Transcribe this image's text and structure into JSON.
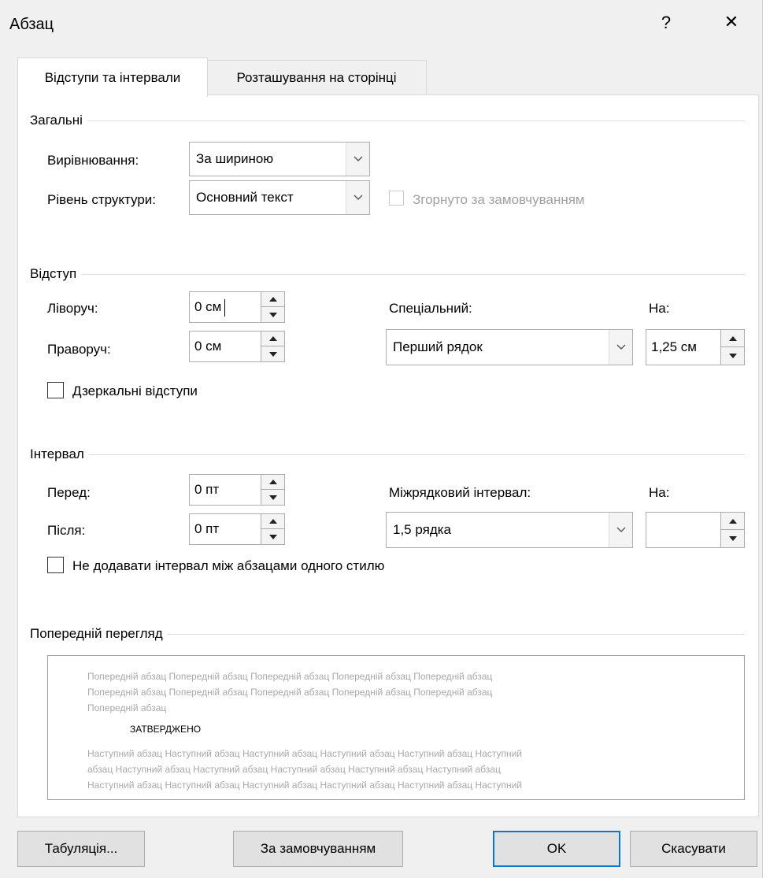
{
  "dialog": {
    "title": "Абзац",
    "help_glyph": "?",
    "close_glyph": "✕"
  },
  "tabs": [
    {
      "label": "Відступи та інтервали",
      "active": true
    },
    {
      "label": "Розташування на сторінці",
      "active": false
    }
  ],
  "general": {
    "heading": "Загальні",
    "alignment_label": "Вирівнювання:",
    "alignment_value": "За шириною",
    "outline_label": "Рівень структури:",
    "outline_value": "Основний текст",
    "collapsed_label": "Згорнуто за замовчуванням"
  },
  "indent": {
    "heading": "Відступ",
    "left_label": "Ліворуч:",
    "left_value": "0 см",
    "right_label": "Праворуч:",
    "right_value": "0 см",
    "special_label": "Спеціальний:",
    "special_value": "Перший рядок",
    "by_label": "На:",
    "by_value": "1,25 см",
    "mirror_label": "Дзеркальні відступи"
  },
  "spacing": {
    "heading": "Інтервал",
    "before_label": "Перед:",
    "before_value": "0 пт",
    "after_label": "Після:",
    "after_value": "0 пт",
    "line_label": "Міжрядковий інтервал:",
    "line_value": "1,5 рядка",
    "at_label": "На:",
    "at_value": "",
    "no_space_label": "Не додавати інтервал між абзацами одного стилю"
  },
  "preview": {
    "heading": "Попередній перегляд",
    "prev_lines": [
      "Попередній абзац Попередній абзац Попередній абзац Попередній абзац Попередній абзац",
      "Попередній абзац Попередній абзац Попередній абзац Попередній абзац Попередній абзац",
      "Попередній абзац"
    ],
    "current_text": "ЗАТВЕРДЖЕНО",
    "next_lines": [
      "Наступний абзац Наступний абзац Наступний абзац Наступний абзац Наступний абзац Наступний",
      "абзац Наступний абзац Наступний абзац Наступний абзац Наступний абзац Наступний абзац",
      "Наступний абзац Наступний абзац Наступний абзац Наступний абзац Наступний абзац Наступний"
    ]
  },
  "buttons": {
    "tabs": "Табуляція...",
    "default": "За замовчуванням",
    "ok": "OK",
    "cancel": "Скасувати"
  },
  "colors": {
    "frame": "#f0f0f0",
    "panel": "#ffffff",
    "accent": "#0078d7",
    "disabled_text": "#a0a0a0"
  }
}
